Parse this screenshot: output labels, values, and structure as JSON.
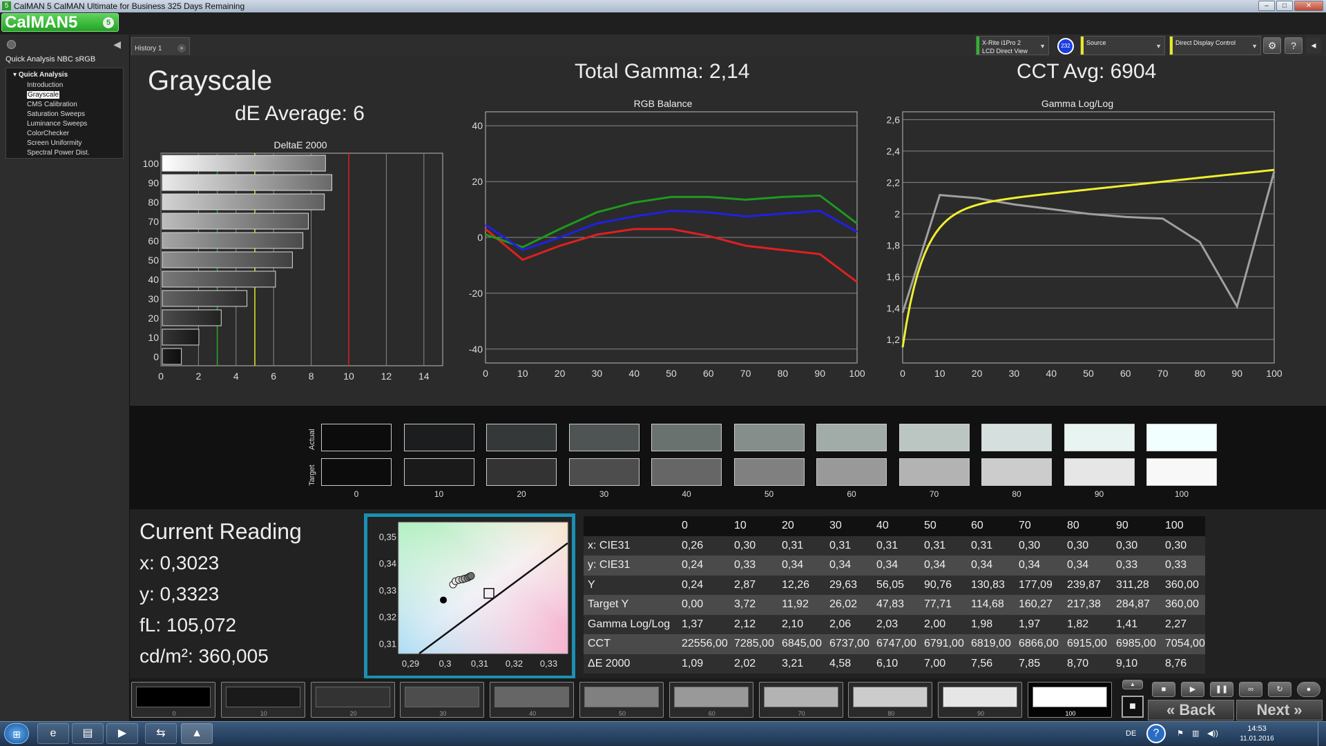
{
  "window": {
    "title": "CalMAN 5 CalMAN Ultimate for Business 325 Days Remaining",
    "app_icon": "5",
    "logo": "CalMAN",
    "logo_version": "5",
    "logo_badge": "5"
  },
  "sidebar": {
    "workflow_title": "Quick Analysis NBC sRGB",
    "group": "Quick Analysis",
    "items": [
      {
        "label": "Introduction",
        "selected": false
      },
      {
        "label": "Grayscale",
        "selected": true
      },
      {
        "label": "CMS Calibration",
        "selected": false
      },
      {
        "label": "Saturation Sweeps",
        "selected": false
      },
      {
        "label": "Luminance Sweeps",
        "selected": false
      },
      {
        "label": "ColorChecker",
        "selected": false
      },
      {
        "label": "Screen Uniformity",
        "selected": false
      },
      {
        "label": "Spectral Power Dist.",
        "selected": false
      }
    ]
  },
  "tabs": {
    "history": "History 1",
    "add": "+"
  },
  "devices": {
    "meter_line1": "X-Rite i1Pro 2",
    "meter_line2": "LCD Direct View",
    "meter_badge": "232",
    "source": "Source",
    "display": "Direct Display Control",
    "meter_color": "#2db52d",
    "source_color": "#e8e82a",
    "display_color": "#e8e82a"
  },
  "toolbar_icons": [
    "gear-icon",
    "help-icon",
    "more-icon"
  ],
  "grayscale": {
    "title": "Grayscale",
    "de_average": "dE Average: 6",
    "total_gamma": "Total Gamma: 2,14",
    "cct_avg": "CCT Avg: 6904"
  },
  "chart_data": [
    {
      "type": "bar",
      "title": "DeltaE 2000",
      "orientation": "horizontal",
      "categories": [
        "100",
        "90",
        "80",
        "70",
        "60",
        "50",
        "40",
        "30",
        "20",
        "10",
        "0"
      ],
      "values": [
        8.76,
        9.1,
        8.7,
        7.85,
        7.56,
        7.0,
        6.1,
        4.58,
        3.21,
        2.02,
        1.09
      ],
      "xlim": [
        0,
        15
      ],
      "xticks": [
        "0",
        "2",
        "4",
        "6",
        "8",
        "10",
        "12",
        "14"
      ],
      "threshold_lines": [
        {
          "value": 3,
          "color": "#2da82d"
        },
        {
          "value": 5,
          "color": "#e6e62a"
        },
        {
          "value": 10,
          "color": "#e02020"
        }
      ]
    },
    {
      "type": "line",
      "title": "RGB Balance",
      "x": [
        0,
        10,
        20,
        30,
        40,
        50,
        60,
        70,
        80,
        90,
        100
      ],
      "xticks": [
        "0",
        "10",
        "20",
        "30",
        "40",
        "50",
        "60",
        "70",
        "80",
        "90",
        "100"
      ],
      "ylim": [
        -45,
        45
      ],
      "yticks": [
        "40",
        "20",
        "0",
        "-20",
        "-40"
      ],
      "series": [
        {
          "color": "#e02020",
          "values": [
            3,
            -8,
            -3,
            1,
            3,
            3,
            0.5,
            -3,
            -4.5,
            -6,
            -16
          ]
        },
        {
          "color": "#1e9a1e",
          "values": [
            1,
            -3.5,
            3,
            9,
            12.5,
            14.5,
            14.5,
            13.5,
            14.5,
            15,
            5
          ]
        },
        {
          "color": "#2020e6",
          "values": [
            4.5,
            -4.5,
            0,
            5,
            7.5,
            9.5,
            9,
            7.5,
            8.5,
            9.5,
            2
          ]
        }
      ]
    },
    {
      "type": "line",
      "title": "Gamma Log/Log",
      "x": [
        0,
        10,
        20,
        30,
        40,
        50,
        60,
        70,
        80,
        90,
        100
      ],
      "xticks": [
        "0",
        "10",
        "20",
        "30",
        "40",
        "50",
        "60",
        "70",
        "80",
        "90",
        "100"
      ],
      "ylim": [
        1.05,
        2.65
      ],
      "yticks": [
        "2,6",
        "2,4",
        "2,2",
        "2",
        "1,8",
        "1,6",
        "1,4",
        "1,2"
      ],
      "series": [
        {
          "color": "#a0a0a0",
          "values": [
            1.37,
            2.12,
            2.1,
            2.06,
            2.03,
            2.0,
            1.98,
            1.97,
            1.82,
            1.41,
            2.27
          ]
        },
        {
          "color": "#f0f030",
          "curve": "power-law-target",
          "target_gamma": 2.28
        }
      ]
    },
    {
      "type": "scatter",
      "title": "CIE",
      "xticks": [
        "0,29",
        "0,3",
        "0,31",
        "0,32",
        "0,33"
      ],
      "yticks": [
        "0,35",
        "0,34",
        "0,33",
        "0,32",
        "0,31"
      ],
      "xlim": [
        0.2865,
        0.3355
      ],
      "ylim": [
        0.3065,
        0.3555
      ],
      "target_marker": {
        "x": 0.3127,
        "y": 0.329
      },
      "reference_dot": {
        "x": 0.2995,
        "y": 0.3265
      },
      "points": [
        {
          "x": 0.3023,
          "y": 0.3323
        },
        {
          "x": 0.303,
          "y": 0.3335
        },
        {
          "x": 0.304,
          "y": 0.334
        },
        {
          "x": 0.305,
          "y": 0.3342
        },
        {
          "x": 0.3057,
          "y": 0.3345
        },
        {
          "x": 0.3065,
          "y": 0.3348
        },
        {
          "x": 0.307,
          "y": 0.3352
        },
        {
          "x": 0.3075,
          "y": 0.3355
        }
      ]
    }
  ],
  "swatches": {
    "row_actual": "Actual",
    "row_target": "Target",
    "labels": [
      "0",
      "10",
      "20",
      "30",
      "40",
      "50",
      "60",
      "70",
      "80",
      "90",
      "100"
    ],
    "actual_colors": [
      "#0c0c0c",
      "#1c1d1e",
      "#343838",
      "#4e5453",
      "#6a7270",
      "#858e8b",
      "#a1aba8",
      "#bbc6c3",
      "#d5e0de",
      "#e8f4f1",
      "#f1fffe"
    ],
    "target_colors": [
      "#0c0c0c",
      "#1a1a1a",
      "#333333",
      "#4d4d4d",
      "#666666",
      "#808080",
      "#999999",
      "#b3b3b3",
      "#cccccc",
      "#e6e6e6",
      "#f8f8f8"
    ]
  },
  "reading": {
    "title": "Current Reading",
    "x": "x: 0,3023",
    "y": "y: 0,3323",
    "fl": "fL: 105,072",
    "cdm2": "cd/m²: 360,005"
  },
  "table": {
    "headers": [
      "0",
      "10",
      "20",
      "30",
      "40",
      "50",
      "60",
      "70",
      "80",
      "90",
      "100"
    ],
    "rows": [
      {
        "label": "x: CIE31",
        "values": [
          "0,26",
          "0,30",
          "0,31",
          "0,31",
          "0,31",
          "0,31",
          "0,31",
          "0,30",
          "0,30",
          "0,30",
          "0,30"
        ]
      },
      {
        "label": "y: CIE31",
        "values": [
          "0,24",
          "0,33",
          "0,34",
          "0,34",
          "0,34",
          "0,34",
          "0,34",
          "0,34",
          "0,34",
          "0,33",
          "0,33"
        ]
      },
      {
        "label": "Y",
        "values": [
          "0,24",
          "2,87",
          "12,26",
          "29,63",
          "56,05",
          "90,76",
          "130,83",
          "177,09",
          "239,87",
          "311,28",
          "360,00"
        ]
      },
      {
        "label": "Target Y",
        "values": [
          "0,00",
          "3,72",
          "11,92",
          "26,02",
          "47,83",
          "77,71",
          "114,68",
          "160,27",
          "217,38",
          "284,87",
          "360,00"
        ]
      },
      {
        "label": "Gamma Log/Log",
        "values": [
          "1,37",
          "2,12",
          "2,10",
          "2,06",
          "2,03",
          "2,00",
          "1,98",
          "1,97",
          "1,82",
          "1,41",
          "2,27"
        ]
      },
      {
        "label": "CCT",
        "values": [
          "22556,00",
          "7285,00",
          "6845,00",
          "6737,00",
          "6747,00",
          "6791,00",
          "6819,00",
          "6866,00",
          "6915,00",
          "6985,00",
          "7054,00"
        ]
      },
      {
        "label": "ΔE 2000",
        "values": [
          "1,09",
          "2,02",
          "3,21",
          "4,58",
          "6,10",
          "7,00",
          "7,56",
          "7,85",
          "8,70",
          "9,10",
          "8,76"
        ]
      }
    ]
  },
  "patches": {
    "labels": [
      "0",
      "10",
      "20",
      "30",
      "40",
      "50",
      "60",
      "70",
      "80",
      "90",
      "100"
    ],
    "colors": [
      "#000000",
      "#1a1a1a",
      "#333333",
      "#4d4d4d",
      "#666666",
      "#808080",
      "#999999",
      "#b3b3b3",
      "#cccccc",
      "#e6e6e6",
      "#ffffff"
    ],
    "selected": "100"
  },
  "nav": {
    "back": "Back",
    "next": "Next"
  },
  "taskbar": {
    "apps": [
      "internet-explorer-icon",
      "explorer-icon",
      "media-player-icon",
      "teamviewer-icon",
      "calman-icon"
    ],
    "lang": "DE",
    "time": "14:53",
    "date": "11.01.2016"
  }
}
